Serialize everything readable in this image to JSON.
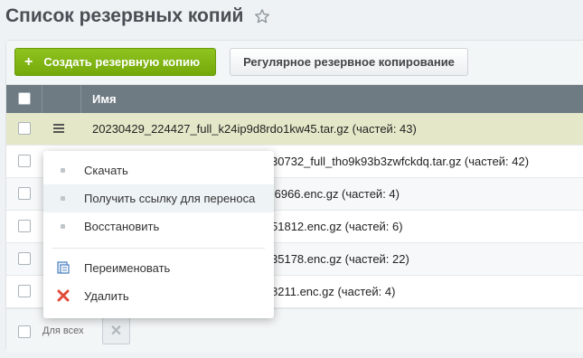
{
  "page": {
    "title": "Список резервных копий"
  },
  "toolbar": {
    "create_label": "Создать резервную копию",
    "regular_label": "Регулярное резервное копирование"
  },
  "grid": {
    "column_name": "Имя",
    "rows": [
      {
        "name": "20230429_224427_full_k24ip9d8rdo1kw45.tar.gz (частей: 43)"
      },
      {
        "name": "30732_full_tho9k93b3zwfckdq.tar.gz (частей: 42)"
      },
      {
        "name": ".6966.enc.gz (частей: 4)"
      },
      {
        "name": "51812.enc.gz (частей: 6)"
      },
      {
        "name": "35178.enc.gz (частей: 22)"
      },
      {
        "name": "8211.enc.gz (частей: 4)"
      }
    ]
  },
  "footer": {
    "for_all": "Для всех",
    "delete_symbol": "✕"
  },
  "context_menu": {
    "items": [
      {
        "label": "Скачать"
      },
      {
        "label": "Получить ссылку для переноса"
      },
      {
        "label": "Восстановить"
      },
      {
        "label": "Переименовать"
      },
      {
        "label": "Удалить"
      }
    ]
  },
  "colors": {
    "accent_green": "#7ab317",
    "header_gray": "#6f7b83",
    "selected_row": "#e5e8c8",
    "delete_red": "#e04b3a"
  }
}
